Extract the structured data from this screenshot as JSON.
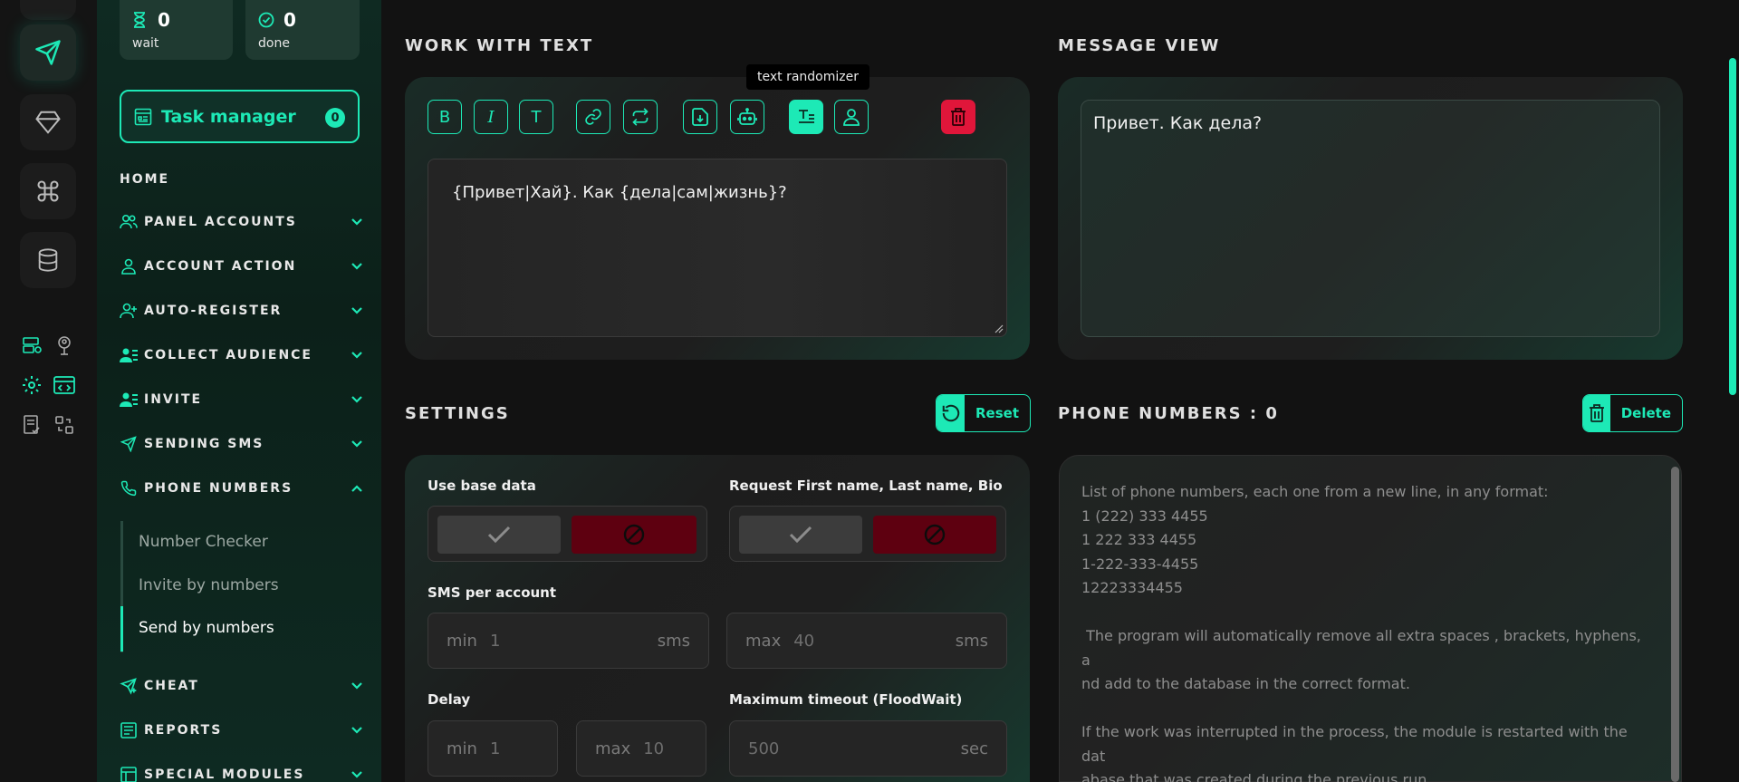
{
  "stats": {
    "wait": {
      "value": "0",
      "label": "wait"
    },
    "done": {
      "value": "0",
      "label": "done"
    }
  },
  "task_manager": {
    "label": "Task manager",
    "count": "0"
  },
  "nav": {
    "home": "HOME",
    "items": [
      {
        "label": "PANEL ACCOUNTS",
        "icon": "users-icon",
        "open": false
      },
      {
        "label": "ACCOUNT ACTION",
        "icon": "user-icon",
        "open": false
      },
      {
        "label": "AUTO-REGISTER",
        "icon": "user-plus-icon",
        "open": false
      },
      {
        "label": "COLLECT AUDIENCE",
        "icon": "user-list-icon",
        "open": false
      },
      {
        "label": "INVITE",
        "icon": "user-list-icon",
        "open": false
      },
      {
        "label": "SENDING SMS",
        "icon": "send-icon",
        "open": false
      },
      {
        "label": "PHONE NUMBERS",
        "icon": "phone-icon",
        "open": true
      },
      {
        "label": "CHEAT",
        "icon": "send-plus-icon",
        "open": false
      },
      {
        "label": "REPORTS",
        "icon": "report-icon",
        "open": false
      },
      {
        "label": "SPECIAL MODULES",
        "icon": "modules-icon",
        "open": false
      }
    ],
    "sub_items": [
      "Number Checker",
      "Invite by numbers",
      "Send by numbers"
    ],
    "active_sub": "Send by numbers"
  },
  "work_with_text": {
    "title": "WORK WITH TEXT",
    "tooltip": "text randomizer",
    "tools": [
      "B",
      "I",
      "T"
    ],
    "text": "{Привет|Хай}. Как {дела|сам|жизнь}?"
  },
  "message_view": {
    "title": "MESSAGE VIEW",
    "text": "Привет. Как дела?"
  },
  "settings": {
    "title": "SETTINGS",
    "reset_label": "Reset",
    "use_base_data": "Use base data",
    "request_names": "Request First name, Last name, Bio",
    "sms_per_account": "SMS per account",
    "sms_min": {
      "prefix": "min",
      "placeholder": "1",
      "unit": "sms"
    },
    "sms_max": {
      "prefix": "max",
      "placeholder": "40",
      "unit": "sms"
    },
    "delay": "Delay",
    "delay_min": {
      "prefix": "min",
      "placeholder": "1"
    },
    "delay_max": {
      "prefix": "max",
      "placeholder": "10"
    },
    "max_timeout": "Maximum timeout (FloodWait)",
    "timeout": {
      "placeholder": "500",
      "unit": "sec"
    }
  },
  "phone_numbers": {
    "title": "PHONE NUMBERS : 0",
    "delete_label": "Delete",
    "placeholder": "List of phone numbers, each one from a new line, in any format:\n1 (222) 333 4455\n1 222 333 4455\n1-222-333-4455\n12223334455\n\n The program will automatically remove all extra spaces , brackets, hyphens, a\nnd add to the database in the correct format.\n\nIf the work was interrupted in the process, the module is restarted with the dat\nabase that was created during the previous run.\nIt allows you to pick up from where you left off."
  },
  "colors": {
    "accent": "#1de9b6",
    "danger": "#e0163a",
    "danger_dark": "#5e0010"
  }
}
